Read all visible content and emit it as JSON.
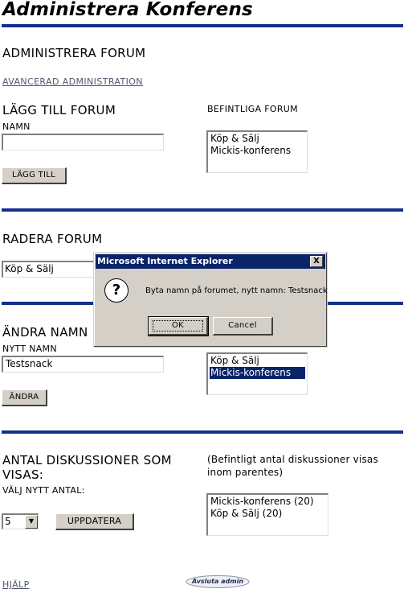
{
  "page": {
    "title": "Administrera Konferens",
    "section_admin_forum": "ADMINISTRERA FORUM",
    "advanced_link": "AVANCERAD ADMINISTRATION",
    "help_link": "HJÄLP",
    "logout_button": "Avsluta admin"
  },
  "add_forum": {
    "heading": "LÄGG TILL FORUM",
    "name_label": "NAMN",
    "name_value": "",
    "add_button": "LÄGG TILL",
    "existing_label": "BEFINTLIGA FORUM",
    "existing_items": [
      "Köp & Sälj",
      "Mickis-konferens"
    ]
  },
  "delete_forum": {
    "heading": "RADERA FORUM",
    "selected": "Köp & Sälj"
  },
  "rename": {
    "heading": "ÄNDRA NAMN",
    "new_name_label": "NYTT NAMN",
    "new_name_value": "Testsnack",
    "change_button": "ÄNDRA",
    "list_items": [
      "Köp & Sälj",
      "Mickis-konferens"
    ],
    "selected_item": "Mickis-konferens"
  },
  "discussions": {
    "heading_line1": "ANTAL DISKUSSIONER SOM",
    "heading_line2": "VISAS:",
    "note_line1": "(Befintligt antal diskussioner visas",
    "note_line2": "inom parentes)",
    "choose_label": "VÄLJ NYTT ANTAL:",
    "count_value": "5",
    "update_button": "UPPDATERA",
    "list_items": [
      "Mickis-konferens (20)",
      "Köp & Sälj (20)"
    ]
  },
  "dialog": {
    "title": "Microsoft Internet Explorer",
    "message": "Byta namn på forumet, nytt namn: Testsnack",
    "ok_button": "OK",
    "cancel_button": "Cancel",
    "close_glyph": "X",
    "icon": "question-icon",
    "icon_glyph": "?"
  },
  "colors": {
    "rule": "#12308c",
    "titlebar": "#0a246a",
    "selection": "#0a246a",
    "dialog_bg": "#d4d0c8"
  }
}
